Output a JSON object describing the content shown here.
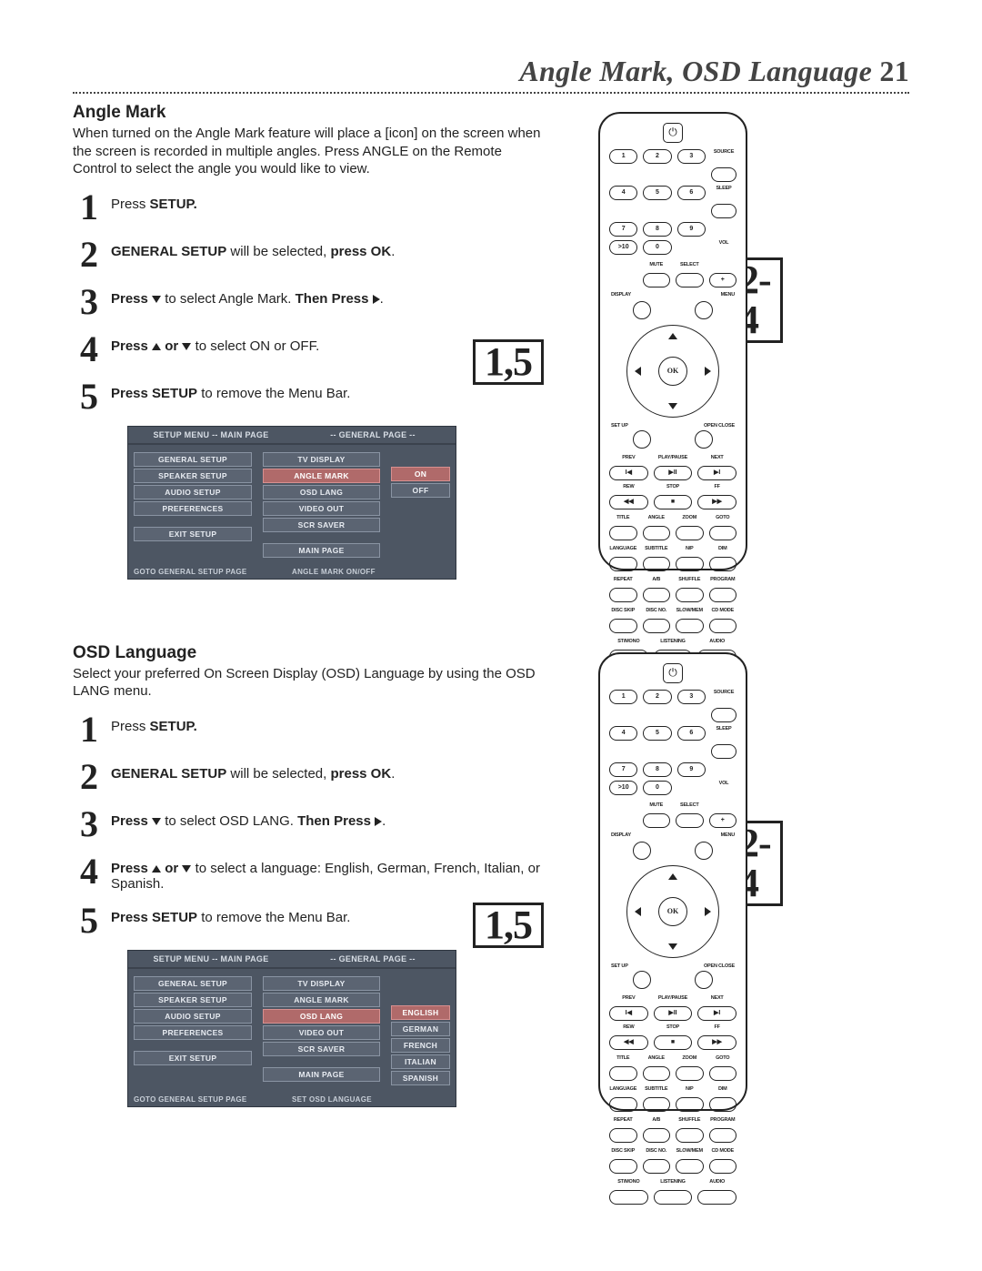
{
  "header": {
    "title": "Angle Mark, OSD Language",
    "page_number": "21"
  },
  "section_a": {
    "title": "Angle Mark",
    "intro": "When turned on the Angle Mark feature will place a [icon] on the screen when the screen is recorded in multiple angles.  Press ANGLE on the Remote Control to select the angle you would like to view.",
    "steps": {
      "s1_num": "1",
      "s1_pre": "Press ",
      "s1_b": "SETUP.",
      "s1_post": "",
      "s2_num": "2",
      "s2_b1": "GENERAL SETUP",
      "s2_mid": " will be selected, ",
      "s2_b2": "press OK",
      "s2_end": ".",
      "s3_num": "3",
      "s3_b1": "Press",
      "s3_mid": " to select Angle Mark. ",
      "s3_b2": "Then Press",
      "s3_end": ".",
      "s4_num": "4",
      "s4_b1": "Press",
      "s4_mid": " or ",
      "s4_post": " to select ON or OFF.",
      "s5_num": "5",
      "s5_b1": "Press SETUP",
      "s5_post": " to remove the Menu Bar."
    },
    "osd": {
      "header_left": "SETUP MENU -- MAIN PAGE",
      "header_right": "-- GENERAL PAGE --",
      "menu": [
        "GENERAL SETUP",
        "SPEAKER SETUP",
        "AUDIO SETUP",
        "PREFERENCES"
      ],
      "exit": "EXIT SETUP",
      "sub": [
        "TV DISPLAY",
        "ANGLE MARK",
        "OSD LANG",
        "VIDEO OUT",
        "SCR SAVER"
      ],
      "main_page": "MAIN PAGE",
      "opts": [
        "ON",
        "OFF"
      ],
      "footer_left": "GOTO GENERAL SETUP PAGE",
      "footer_right": "ANGLE MARK ON/OFF"
    },
    "callouts": {
      "c15": "1,5",
      "c24": "2-4"
    }
  },
  "section_b": {
    "title": "OSD Language",
    "intro": "Select your preferred On Screen Display (OSD) Language by using the OSD LANG menu.",
    "steps": {
      "s1_num": "1",
      "s1_pre": "Press ",
      "s1_b": "SETUP.",
      "s1_post": "",
      "s2_num": "2",
      "s2_b1": "GENERAL SETUP",
      "s2_mid": " will be selected, ",
      "s2_b2": "press OK",
      "s2_end": ".",
      "s3_num": "3",
      "s3_b1": "Press",
      "s3_mid": " to select OSD LANG. ",
      "s3_b2": "Then Press",
      "s3_end": ".",
      "s4_num": "4",
      "s4_b1": "Press",
      "s4_mid": " or ",
      "s4_post": " to select a language: English, German, French, Italian, or Spanish.",
      "s5_num": "5",
      "s5_b1": "Press SETUP",
      "s5_post": " to remove the Menu Bar."
    },
    "osd": {
      "header_left": "SETUP MENU -- MAIN PAGE",
      "header_right": "-- GENERAL PAGE --",
      "menu": [
        "GENERAL SETUP",
        "SPEAKER SETUP",
        "AUDIO SETUP",
        "PREFERENCES"
      ],
      "exit": "EXIT SETUP",
      "sub": [
        "TV DISPLAY",
        "ANGLE MARK",
        "OSD LANG",
        "VIDEO OUT",
        "SCR SAVER"
      ],
      "main_page": "MAIN PAGE",
      "opts": [
        "ENGLISH",
        "GERMAN",
        "FRENCH",
        "ITALIAN",
        "SPANISH"
      ],
      "footer_left": "GOTO GENERAL SETUP PAGE",
      "footer_right": "SET OSD LANGUAGE"
    },
    "callouts": {
      "c15": "1,5",
      "c24": "2-4"
    }
  },
  "remote": {
    "row_labels_top_right": "SOURCE",
    "num_btns": [
      "1",
      "2",
      "3",
      "4",
      "5",
      "6",
      "7",
      "8",
      "9",
      ">10",
      "0"
    ],
    "sleep": "SLEEP",
    "vol": "VOL",
    "mute": "MUTE",
    "select": "SELECT",
    "display": "DISPLAY",
    "menu": "MENU",
    "setup": "SET UP",
    "open_close": "OPEN CLOSE",
    "prev": "PREV",
    "play_pause": "PLAY/PAUSE",
    "next": "NEXT",
    "rew": "REW",
    "stop": "STOP",
    "ff": "FF",
    "play_pause_sym": "▶II",
    "stop_sym": "■",
    "prev_sym": "I◀",
    "next_sym": "▶I",
    "rew_sym": "◀◀",
    "ff_sym": "▶▶",
    "row6": [
      "TITLE",
      "ANGLE",
      "ZOOM",
      "GOTO"
    ],
    "row7": [
      "LANGUAGE",
      "SUBTITLE",
      "N/P",
      "DIM"
    ],
    "row8": [
      "REPEAT",
      "A/B",
      "SHUFFLE",
      "PROGRAM"
    ],
    "row9": [
      "DISC SKIP",
      "DISC NO.",
      "SLOW/MEM",
      "CD MODE"
    ],
    "row10": [
      "ST/MONO",
      "LISTENING",
      "AUDIO"
    ],
    "ok": "OK"
  }
}
